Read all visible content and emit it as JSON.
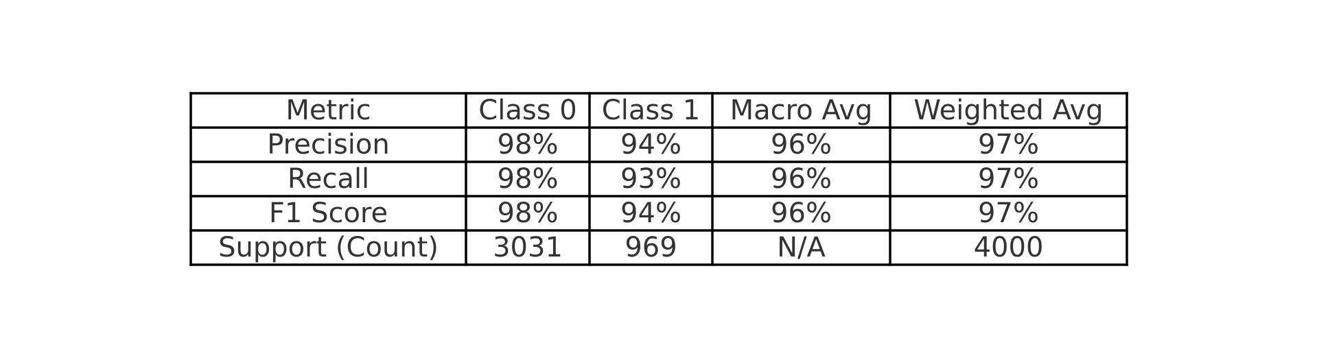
{
  "chart_data": {
    "type": "table",
    "columns": [
      "Metric",
      "Class 0",
      "Class 1",
      "Macro Avg",
      "Weighted Avg"
    ],
    "rows": [
      [
        "Precision",
        "98%",
        "94%",
        "96%",
        "97%"
      ],
      [
        "Recall",
        "98%",
        "93%",
        "96%",
        "97%"
      ],
      [
        "F1 Score",
        "98%",
        "94%",
        "96%",
        "97%"
      ],
      [
        "Support (Count)",
        "3031",
        "969",
        "N/A",
        "4000"
      ]
    ],
    "text_color": "#333333",
    "border_color": "#000000",
    "background": "#ffffff"
  }
}
